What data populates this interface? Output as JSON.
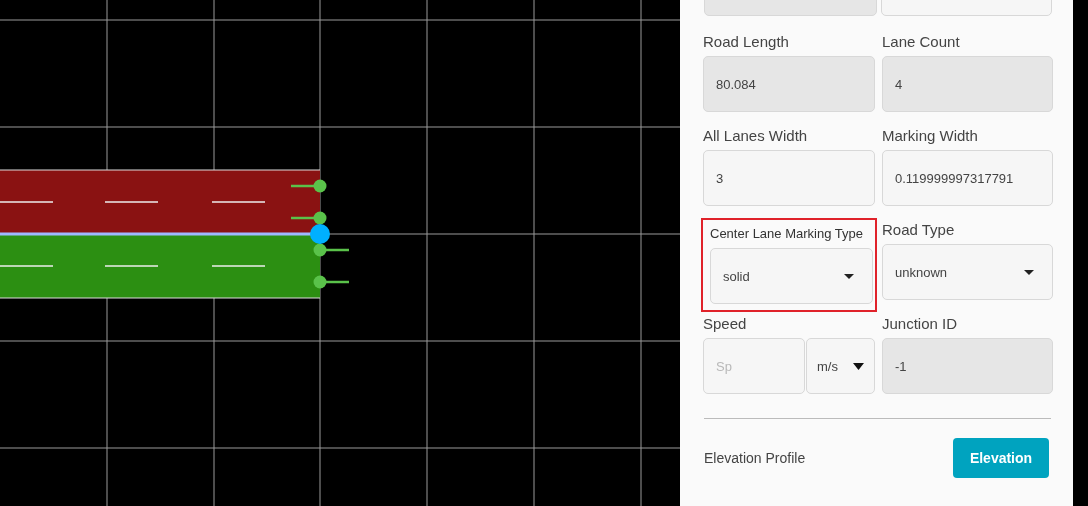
{
  "canvas": {
    "road": {
      "lanes": [
        {
          "color": "#8a1212"
        },
        {
          "color": "#2c8f12"
        }
      ]
    }
  },
  "top_fields": [
    {
      "disabled": true
    },
    {
      "disabled": false
    }
  ],
  "fields": [
    {
      "kind": "text",
      "label": "Road Length",
      "value": "80.084",
      "disabled": true,
      "highlighted": false
    },
    {
      "kind": "text",
      "label": "Lane Count",
      "value": "4",
      "disabled": true,
      "highlighted": false
    },
    {
      "kind": "text",
      "label": "All Lanes Width",
      "value": "3",
      "disabled": false,
      "highlighted": false
    },
    {
      "kind": "text",
      "label": "Marking Width",
      "value": "0.119999997317791",
      "disabled": false,
      "highlighted": false
    },
    {
      "kind": "select",
      "label": "Center Lane Marking Type",
      "value": "solid",
      "disabled": false,
      "highlighted": true
    },
    {
      "kind": "select",
      "label": "Road Type",
      "value": "unknown",
      "disabled": false,
      "highlighted": false
    },
    {
      "kind": "speed",
      "label": "Speed",
      "placeholder": "Sp",
      "unit": "m/s",
      "disabled": false,
      "highlighted": false
    },
    {
      "kind": "text",
      "label": "Junction ID",
      "value": "-1",
      "disabled": true,
      "highlighted": false
    }
  ],
  "elevation": {
    "label": "Elevation Profile",
    "button": "Elevation"
  }
}
